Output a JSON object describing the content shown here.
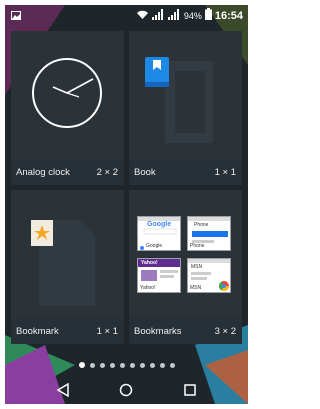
{
  "status_bar": {
    "battery_percent": "94%",
    "time": "16:54",
    "icons": [
      "image-notification-icon",
      "wifi-icon",
      "signal-icon",
      "signal-icon",
      "battery-icon"
    ]
  },
  "widgets": [
    {
      "name": "Analog clock",
      "size": "2 × 2",
      "preview": "analog-clock"
    },
    {
      "name": "Book",
      "size": "1 × 1",
      "preview": "book"
    },
    {
      "name": "Bookmark",
      "size": "1 × 1",
      "preview": "bookmark"
    },
    {
      "name": "Bookmarks",
      "size": "3 × 2",
      "preview": "bookmarks-grid"
    }
  ],
  "bookmark_thumbnails": [
    {
      "caption": "Google",
      "title": "Google"
    },
    {
      "caption": "Phone",
      "title": "Phone"
    },
    {
      "caption": "Yahoo!",
      "title": "Yahoo!"
    },
    {
      "caption": "MSN",
      "title": "MSN"
    }
  ],
  "page_indicator": {
    "count": 10,
    "active_index": 0
  },
  "navigation": {
    "buttons": [
      "back-icon",
      "home-icon",
      "recent-apps-icon"
    ]
  },
  "colors": {
    "tile": "#2b3238",
    "label_bar": "#263036",
    "accent_blue": "#1e88e5",
    "accent_orange": "#f5a623"
  }
}
